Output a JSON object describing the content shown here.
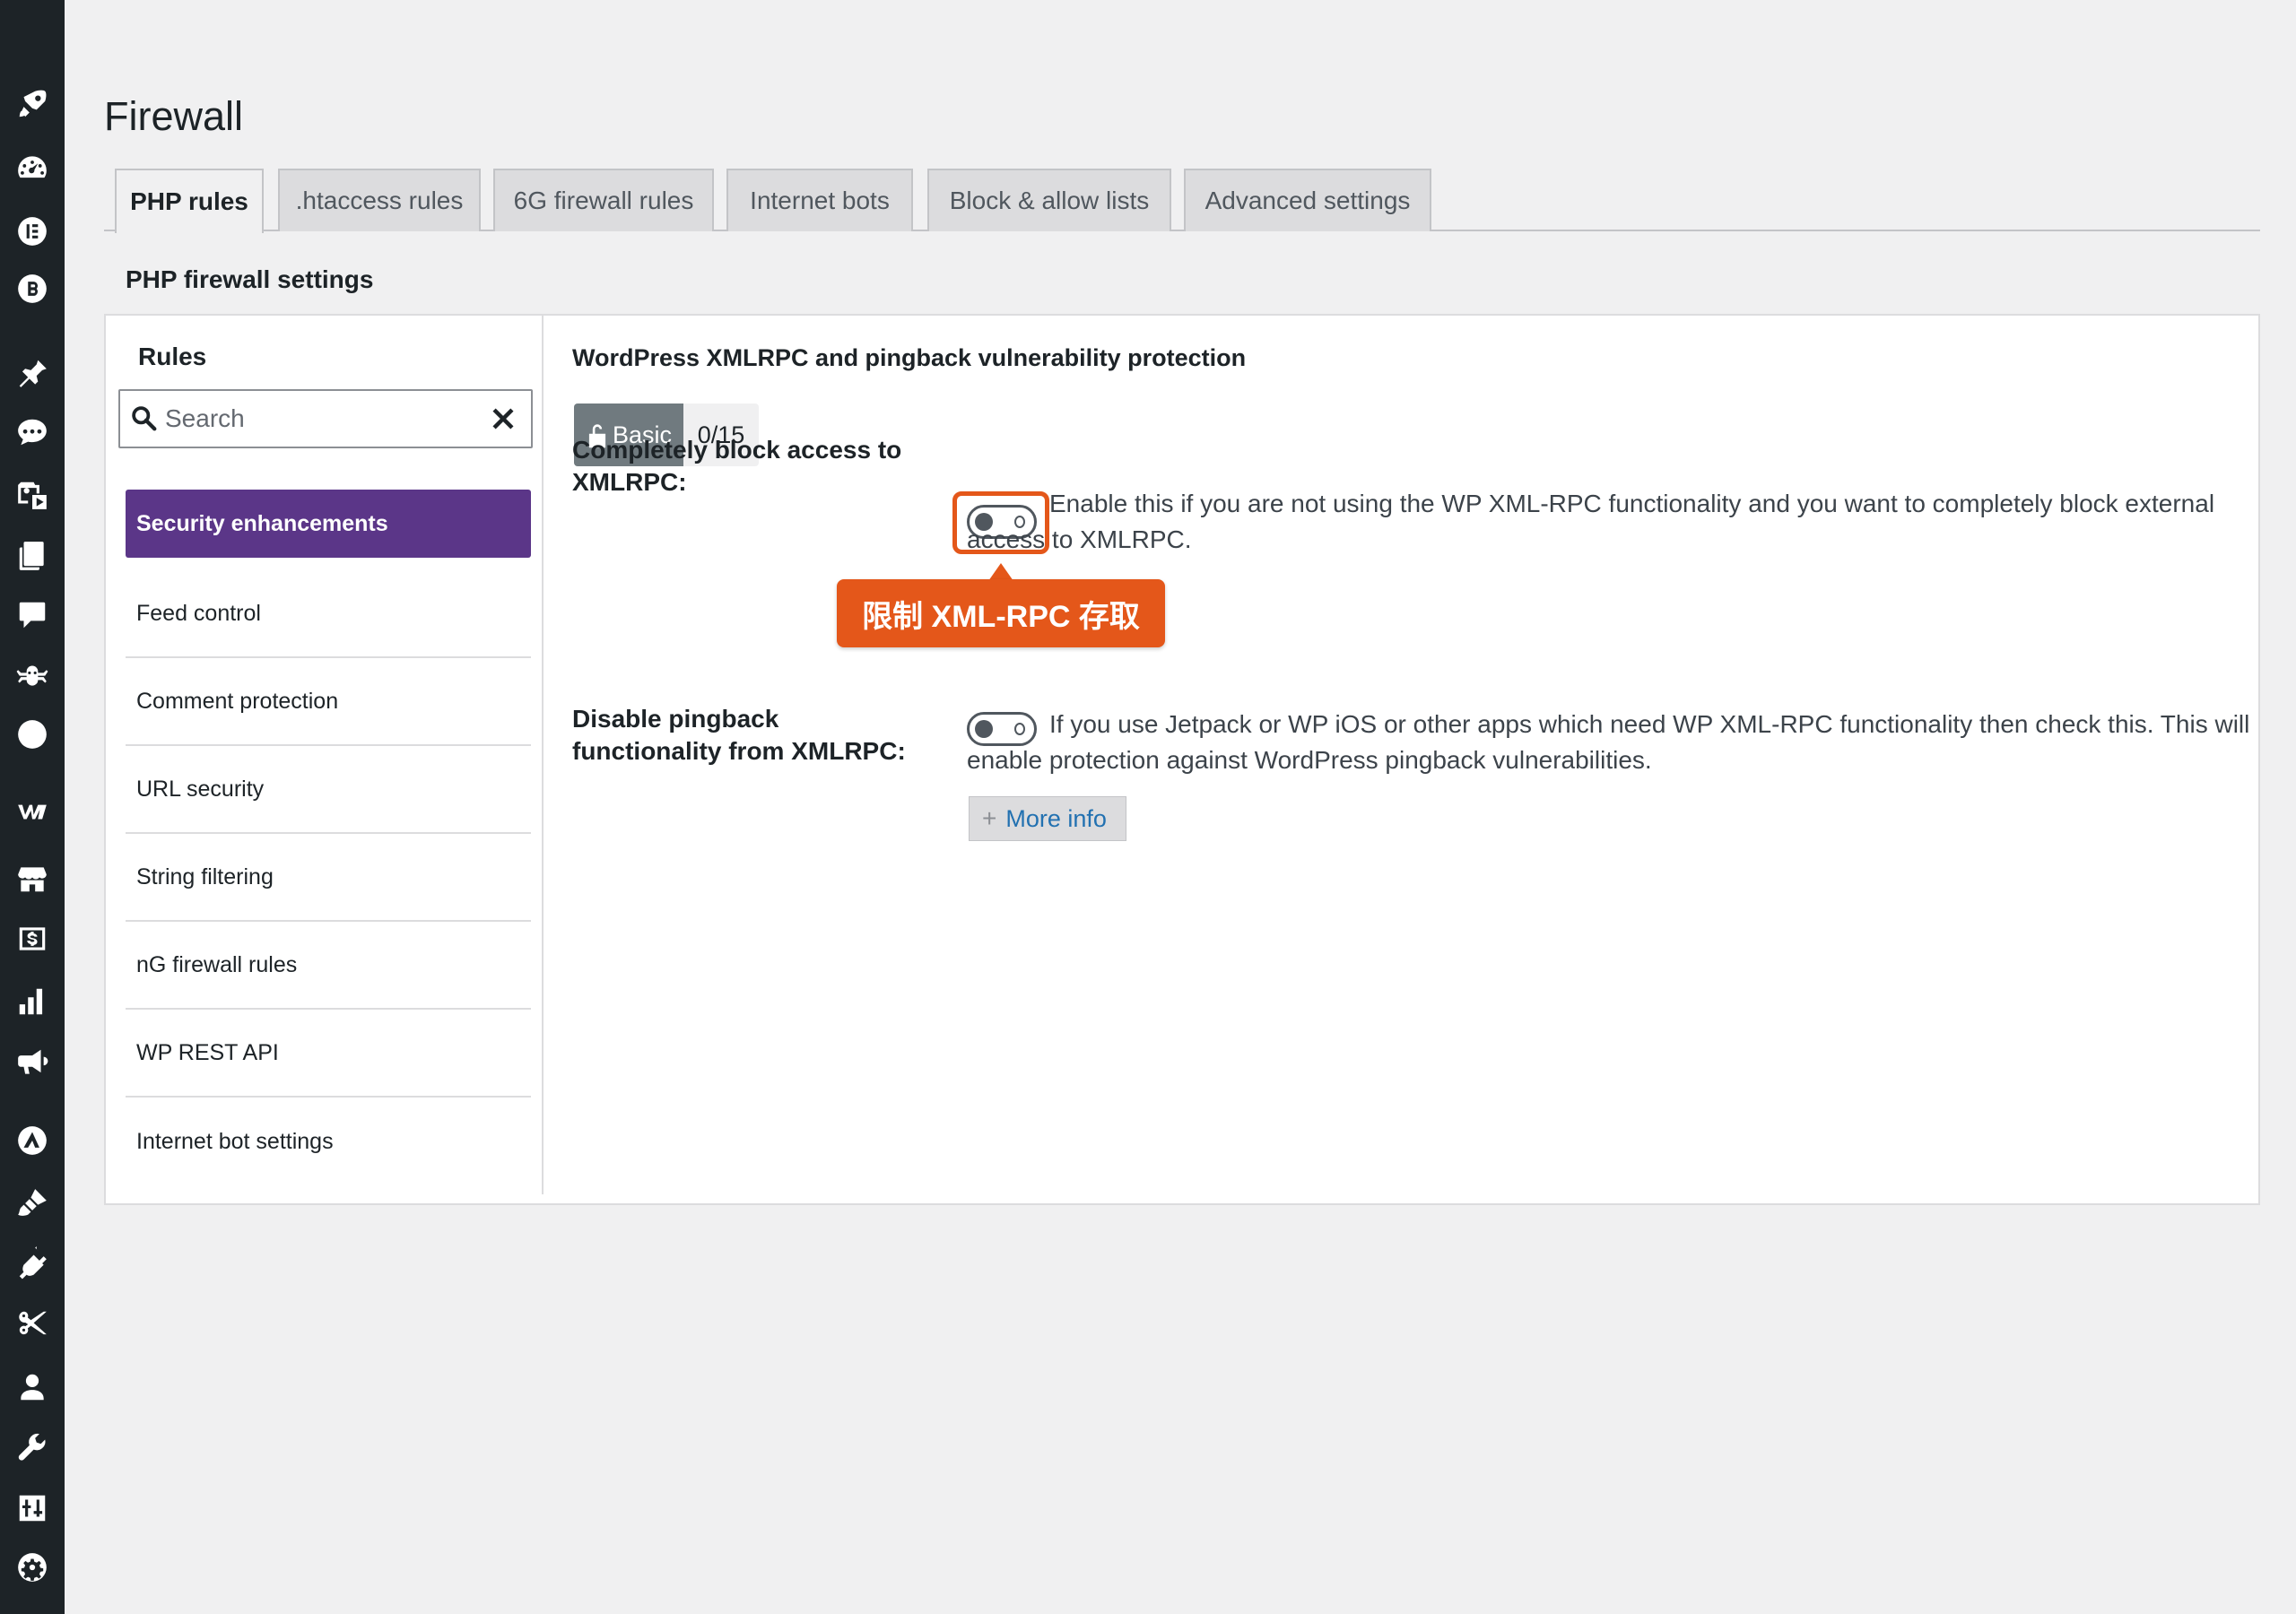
{
  "page": {
    "title": "Firewall"
  },
  "tabs": [
    {
      "label": "PHP rules",
      "active": true
    },
    {
      "label": ".htaccess rules"
    },
    {
      "label": "6G firewall rules"
    },
    {
      "label": "Internet bots"
    },
    {
      "label": "Block & allow lists"
    },
    {
      "label": "Advanced settings"
    }
  ],
  "section_heading": "PHP firewall settings",
  "rules": {
    "title": "Rules",
    "search_placeholder": "Search",
    "items": [
      {
        "label": "Security enhancements",
        "active": true
      },
      {
        "label": "Feed control"
      },
      {
        "label": "Comment protection"
      },
      {
        "label": "URL security"
      },
      {
        "label": "String filtering"
      },
      {
        "label": "nG firewall rules"
      },
      {
        "label": "WP REST API"
      },
      {
        "label": "Internet bot settings"
      }
    ]
  },
  "content": {
    "title": "WordPress XMLRPC and pingback vulnerability protection",
    "level_label": "Basic",
    "level_score": "0/15",
    "settings": [
      {
        "label": "Completely block access to XMLRPC:",
        "enabled": false,
        "description": "Enable this if you are not using the WP XML-RPC functionality and you want to completely block external access to XMLRPC."
      },
      {
        "label": "Disable pingback functionality from XMLRPC:",
        "enabled": false,
        "description": "If you use Jetpack or WP iOS or other apps which need WP XML-RPC functionality then check this. This will enable protection against WordPress pingback vulnerabilities."
      }
    ],
    "more_info_label": "More info"
  },
  "annotation": {
    "callout_text": "限制 XML-RPC 存取",
    "accent_color": "#e4571a"
  },
  "colors": {
    "sidebar_bg": "#1d2327",
    "active_rule_bg": "#5b3688",
    "badge_bg": "#707a7f"
  },
  "sidebar_icons": [
    "rocket-icon",
    "dashboard-icon",
    "elementor-icon",
    "b-badge-icon",
    "pin-icon",
    "chat-bubble-icon",
    "media-icon",
    "pages-icon",
    "comment-icon",
    "spider-icon",
    "s-circle-icon",
    "woo-icon",
    "store-icon",
    "dollar-icon",
    "analytics-icon",
    "megaphone-icon",
    "astra-icon",
    "brush-icon",
    "plugin-icon",
    "scissors-icon",
    "user-icon",
    "wrench-icon",
    "settings-sliders-icon",
    "shield-gear-icon"
  ]
}
